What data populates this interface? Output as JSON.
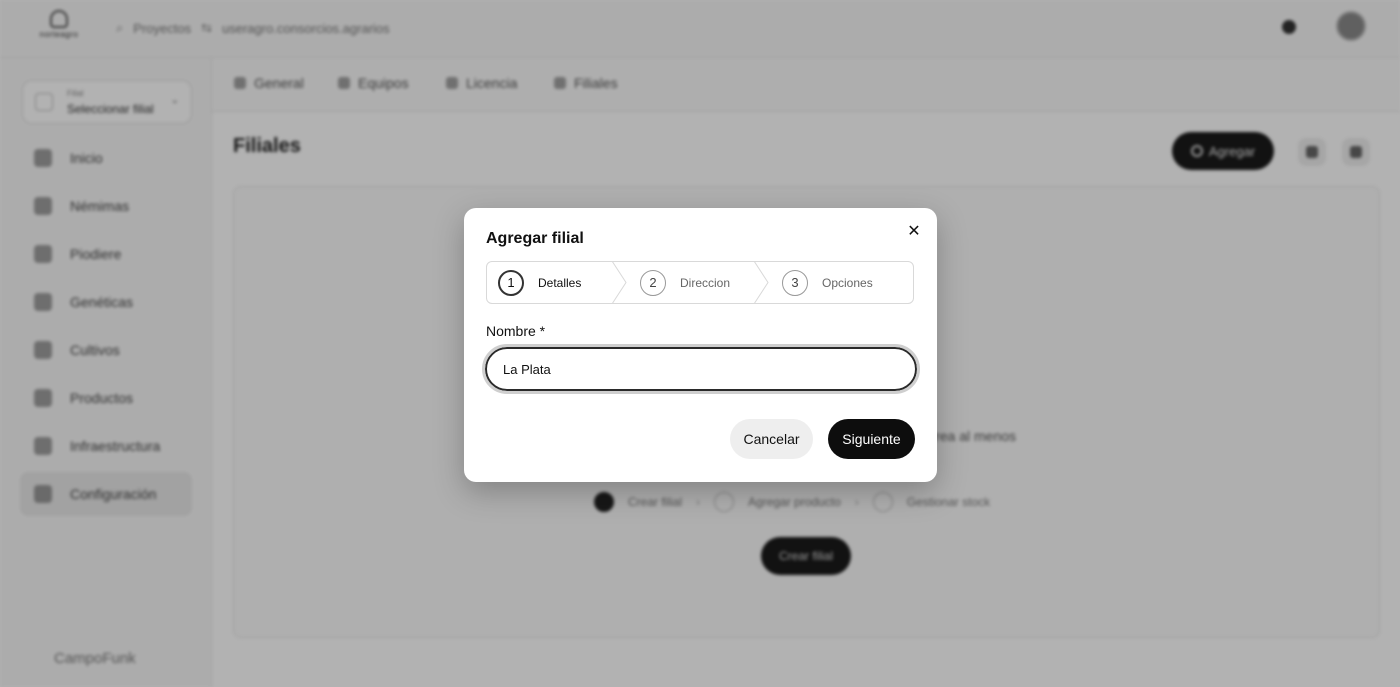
{
  "header": {
    "logo_text": "norteagro",
    "search_icon": "search-icon",
    "breadcrumb_root": "Proyectos",
    "breadcrumb_current": "useragro.consorcios.agrarios"
  },
  "sidebar": {
    "farm_select": {
      "caption": "Filial",
      "value": "Seleccionar filial"
    },
    "items": [
      {
        "label": "Inicio",
        "icon": "home-icon"
      },
      {
        "label": "Némimas",
        "icon": "barn-icon"
      },
      {
        "label": "Piodiere",
        "icon": "settings-icon"
      },
      {
        "label": "Genéticas",
        "icon": "dna-icon"
      },
      {
        "label": "Cultivos",
        "icon": "leaf-icon"
      },
      {
        "label": "Productos",
        "icon": "box-icon"
      },
      {
        "label": "Infraestructura",
        "icon": "building-icon"
      },
      {
        "label": "Configuración",
        "icon": "gear-icon"
      }
    ],
    "brand": "CampoFunk"
  },
  "subtabs": [
    {
      "label": "General",
      "icon": "grid-icon"
    },
    {
      "label": "Equipos",
      "icon": "users-icon"
    },
    {
      "label": "Licencia",
      "icon": "license-icon"
    },
    {
      "label": "Filiales",
      "icon": "branch-icon"
    }
  ],
  "page": {
    "title": "Filiales",
    "add_button": "Agregar",
    "empty_text": "Crea al menos",
    "steps": [
      "Crear filial",
      "Agregar producto",
      "Gestionar stock"
    ],
    "create_button": "Crear filial"
  },
  "modal": {
    "title": "Agregar filial",
    "close_icon": "close-icon",
    "steps": [
      {
        "number": "1",
        "label": "Detalles"
      },
      {
        "number": "2",
        "label": "Direccion"
      },
      {
        "number": "3",
        "label": "Opciones"
      }
    ],
    "active_step": 1,
    "name_label": "Nombre *",
    "name_value": "La Plata",
    "cancel_label": "Cancelar",
    "next_label": "Siguiente"
  }
}
